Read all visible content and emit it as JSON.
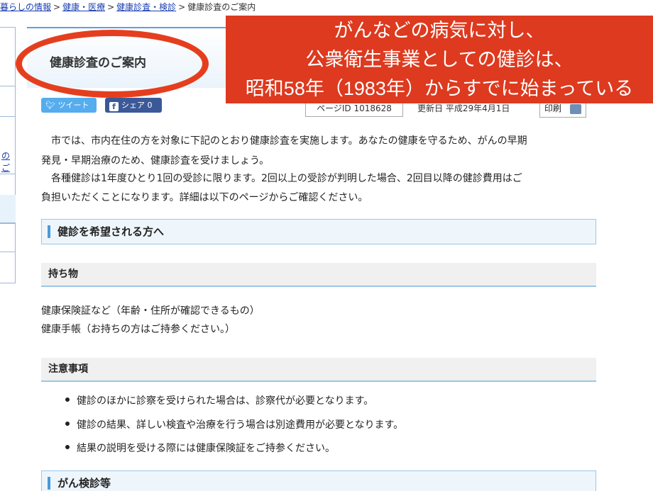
{
  "breadcrumb": {
    "items": [
      "暮らしの情報",
      "健康・医療",
      "健康診査・検診"
    ],
    "current": "健康診査のご案内",
    "separator": ">"
  },
  "sidebar": {
    "partial_link": "のご"
  },
  "page": {
    "title": "健康診査のご案内",
    "share": {
      "tweet_label": "ツイート",
      "share_label": "シェア 0"
    },
    "page_id": "ページID 1018628",
    "updated": "更新日 平成29年4月1日",
    "print_label": "印刷"
  },
  "intro": {
    "p1_line1": "　市では、市内在住の方を対象に下記のとおり健康診査を実施します。あなたの健康を守るため、がんの早期",
    "p1_line2": "発見・早期治療のため、健康診査を受けましょう。",
    "p2_line1": "　各種健診は1年度ひとり1回の受診に限ります。2回以上の受診が判明した場合、2回目以降の健診費用はご",
    "p2_line2": "負担いただくことになります。詳細は以下のページからご確認ください。"
  },
  "sections": {
    "h2_hope": "健診を希望される方へ",
    "h3_items": "持ち物",
    "items_line1": "健康保険証など（年齢・住所が確認できるもの）",
    "items_line2": "健康手帳（お持ちの方はご持参ください。）",
    "h3_notes": "注意事項",
    "notes": [
      "健診のほかに診察を受けられた場合は、診察代が必要となります。",
      "健診の結果、詳しい検査や治療を行う場合は別途費用が必要となります。",
      "結果の説明を受ける際には健康保険証をご持参ください。"
    ],
    "h2_cancer": "がん検診等"
  },
  "annotation": {
    "line1": "がんなどの病気に対し、",
    "line2": "公衆衛生事業としての健診は、",
    "line3": "昭和58年（1983年）からすでに始まっている",
    "color": "#dd3a1f"
  }
}
